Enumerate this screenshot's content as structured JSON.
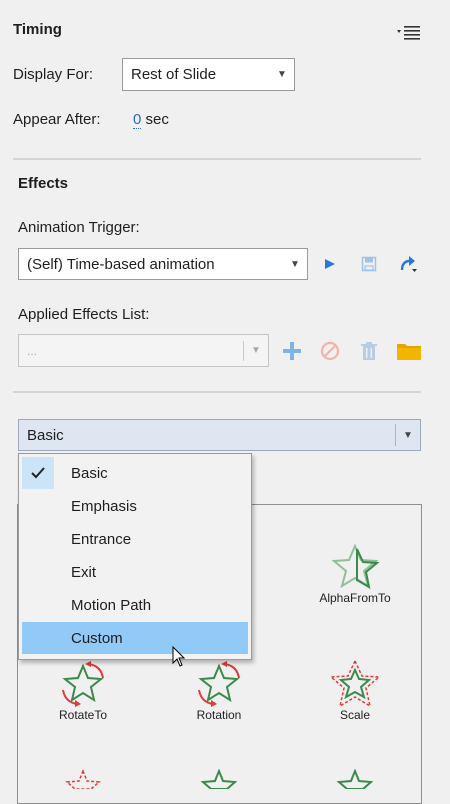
{
  "timing": {
    "title": "Timing",
    "display_for_label": "Display For:",
    "display_for_value": "Rest of Slide",
    "appear_after_label": "Appear After:",
    "appear_after_value": "0",
    "appear_after_unit": "sec"
  },
  "effects": {
    "title": "Effects",
    "trigger_label": "Animation Trigger:",
    "trigger_value": "(Self) Time-based animation",
    "applied_label": "Applied Effects List:",
    "applied_value": "...",
    "category_value": "Basic"
  },
  "menu": {
    "items": [
      {
        "label": "Basic",
        "checked": true
      },
      {
        "label": "Emphasis"
      },
      {
        "label": "Entrance"
      },
      {
        "label": "Exit"
      },
      {
        "label": "Motion Path"
      },
      {
        "label": "Custom",
        "highlighted": true
      }
    ]
  },
  "gallery": {
    "items": [
      {
        "label": "AlphaFromTo"
      },
      {
        "label": "RotateTo"
      },
      {
        "label": "Rotation"
      },
      {
        "label": "Scale"
      }
    ]
  },
  "colors": {
    "accent_blue": "#2a78d6",
    "folder": "#e8a400",
    "star_green": "#3a8a4a",
    "arrow_red": "#e03a3a"
  }
}
